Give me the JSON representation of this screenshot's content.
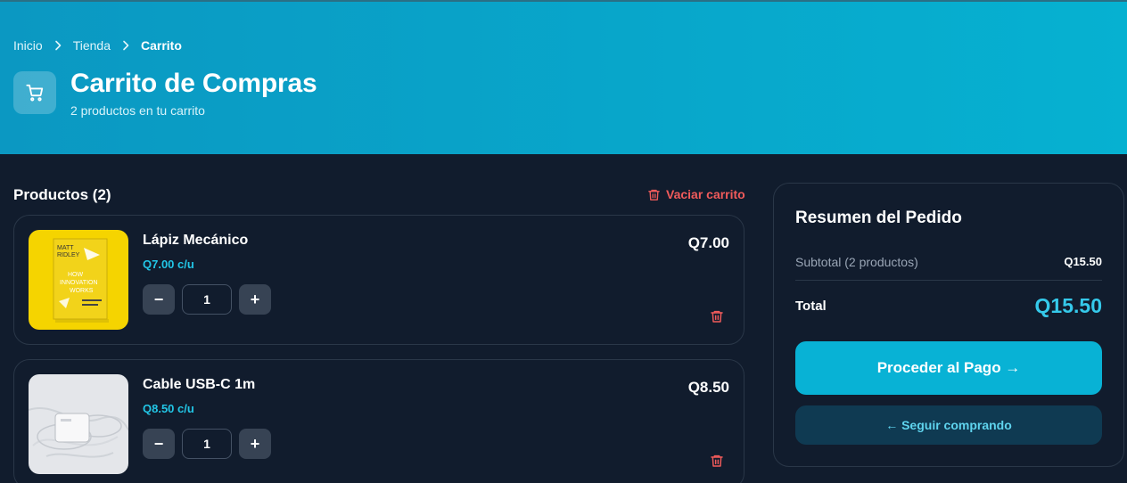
{
  "breadcrumb": {
    "items": [
      "Inicio",
      "Tienda"
    ],
    "current": "Carrito"
  },
  "header": {
    "title": "Carrito de Compras",
    "subtitle": "2 productos en tu carrito",
    "icon": "shopping-cart-icon"
  },
  "products": {
    "heading": "Productos (2)",
    "clear_label": "Vaciar carrito",
    "items": [
      {
        "name": "Lápiz Mecánico",
        "unit_price": "Q7.00 c/u",
        "quantity": "1",
        "total": "Q7.00",
        "image": "book-cover-how-innovation-works",
        "image_text": [
          "MATT",
          "RIDLEY",
          "HOW",
          "INNOVATION",
          "WORKS"
        ]
      },
      {
        "name": "Cable USB-C 1m",
        "unit_price": "Q8.50 c/u",
        "quantity": "1",
        "total": "Q8.50",
        "image": "usb-c-charger-cable-photo"
      }
    ],
    "decrement": "−",
    "increment": "+"
  },
  "summary": {
    "title": "Resumen del Pedido",
    "subtotal_label": "Subtotal (2 productos)",
    "subtotal_value": "Q15.50",
    "total_label": "Total",
    "total_value": "Q15.50",
    "checkout_label": "Proceder al Pago →",
    "continue_label": "← Seguir comprando"
  },
  "colors": {
    "header_start": "#0b98c2",
    "header_end": "#06b1d1",
    "background": "#111c2d",
    "accent": "#08b2d5",
    "danger": "#f15b5b"
  }
}
